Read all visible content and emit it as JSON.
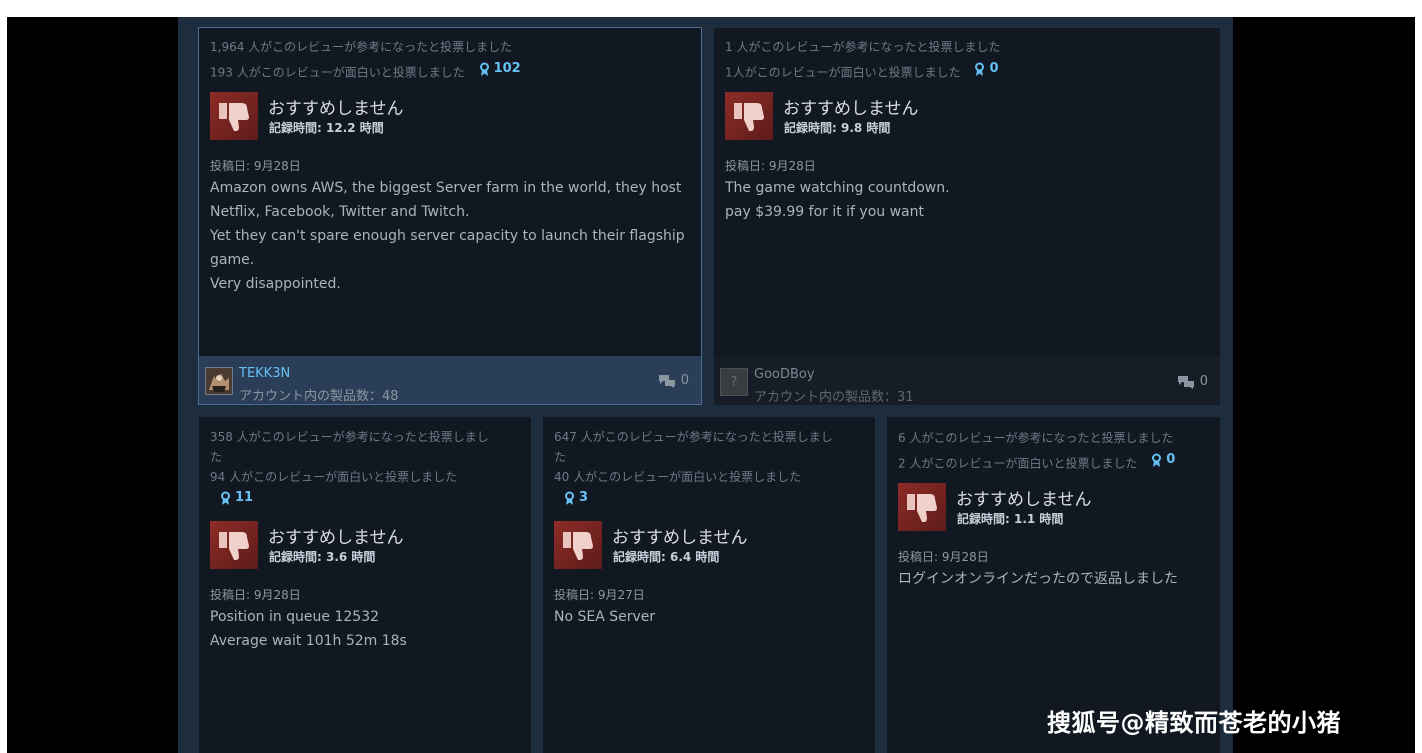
{
  "reviews": [
    {
      "helpful": "1,964 人がこのレビューが参考になったと投票しました",
      "funny": "193 人がこのレビューが面白いと投票しました",
      "awards": "102",
      "verdict": "おすすめしません",
      "playtime": "記録時間: 12.2 時間",
      "posted": "投稿日: 9月28日",
      "text": [
        "Amazon owns AWS, the biggest Server farm in the world, they host",
        "Netflix, Facebook, Twitter and Twitch.",
        "Yet they can't spare enough server capacity to launch their flagship",
        "game.",
        "Very disappointed."
      ],
      "author": "TEKK3N",
      "products": "アカウント内の製品数：48",
      "comments": "0"
    },
    {
      "helpful": "1 人がこのレビューが参考になったと投票しました",
      "funny": "1人がこのレビューが面白いと投票しました",
      "awards": "0",
      "verdict": "おすすめしません",
      "playtime": "記録時間: 9.8 時間",
      "posted": "投稿日: 9月28日",
      "text": [
        "The game watching countdown.",
        "pay $39.99 for it if you want"
      ],
      "author": "GooDBoy",
      "avatar_glyph": "?",
      "products": "アカウント内の製品数：31",
      "comments": "0"
    },
    {
      "helpful_1": "358 人がこのレビューが参考になったと投票しまし",
      "helpful_2": "た",
      "funny": "94 人がこのレビューが面白いと投票しました",
      "awards": "11",
      "verdict": "おすすめしません",
      "playtime": "記録時間: 3.6 時間",
      "posted": "投稿日: 9月28日",
      "text": [
        "Position in queue 12532",
        "Average wait 101h 52m 18s"
      ]
    },
    {
      "helpful_1": "647 人がこのレビューが参考になったと投票しまし",
      "helpful_2": "た",
      "funny": "40 人がこのレビューが面白いと投票しました",
      "awards": "3",
      "verdict": "おすすめしません",
      "playtime": "記録時間: 6.4 時間",
      "posted": "投稿日: 9月27日",
      "text": [
        "No SEA Server"
      ]
    },
    {
      "helpful": "6 人がこのレビューが参考になったと投票しました",
      "funny": "2 人がこのレビューが面白いと投票しました",
      "awards": "0",
      "verdict": "おすすめしません",
      "playtime": "記録時間: 1.1 時間",
      "posted": "投稿日: 9月28日",
      "text": [
        "ログインオンラインだったので返品しました"
      ]
    }
  ],
  "watermark": "搜狐号@精致而苍老的小猪",
  "colors": {
    "background": "#1e2d3d",
    "card": "#111821",
    "accent": "#66c0f4",
    "thumb_down": "#8e2c27"
  },
  "icons": {
    "verdict": "thumbs-down-icon",
    "awards": "award-ribbon-icon",
    "comments": "comment-bubble-icon"
  }
}
